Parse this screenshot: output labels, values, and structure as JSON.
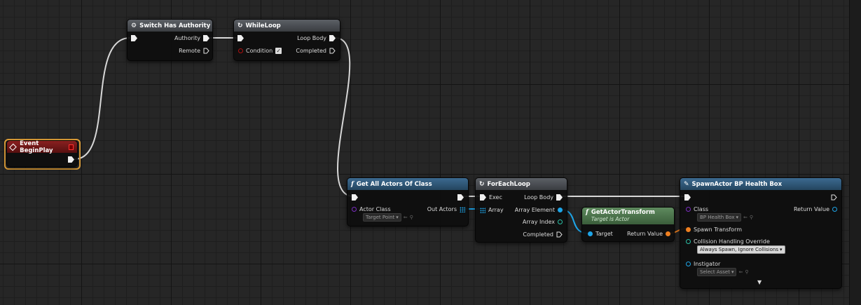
{
  "nodes": {
    "event_begin_play": {
      "title": "Event BeginPlay"
    },
    "switch_authority": {
      "title": "Switch Has Authority",
      "pin_authority": "Authority",
      "pin_remote": "Remote"
    },
    "while_loop": {
      "title": "WhileLoop",
      "pin_condition": "Condition",
      "pin_loop_body": "Loop Body",
      "pin_completed": "Completed"
    },
    "get_all_actors": {
      "title": "Get All Actors Of Class",
      "pin_actor_class": "Actor Class",
      "actor_class_value": "Target Point",
      "pin_out_actors": "Out Actors"
    },
    "for_each_loop": {
      "title": "ForEachLoop",
      "pin_exec": "Exec",
      "pin_array": "Array",
      "pin_loop_body": "Loop Body",
      "pin_array_element": "Array Element",
      "pin_array_index": "Array Index",
      "pin_completed": "Completed"
    },
    "get_actor_transform": {
      "title": "GetActorTransform",
      "subtitle": "Target is Actor",
      "pin_target": "Target",
      "pin_return": "Return Value"
    },
    "spawn_actor": {
      "title": "SpawnActor BP Health Box",
      "pin_class": "Class",
      "class_value": "BP Health Box",
      "pin_return": "Return Value",
      "pin_spawn_transform": "Spawn Transform",
      "pin_collision": "Collision Handling Override",
      "collision_value": "Always Spawn, Ignore Collisions",
      "pin_instigator": "Instigator",
      "instigator_value": "Select Asset"
    }
  },
  "colors": {
    "background": "#262626",
    "exec_wire": "#e0e0e0",
    "object_wire": "#1ea5e8",
    "transform_wire": "#f08020",
    "selection": "#e8a53a"
  }
}
